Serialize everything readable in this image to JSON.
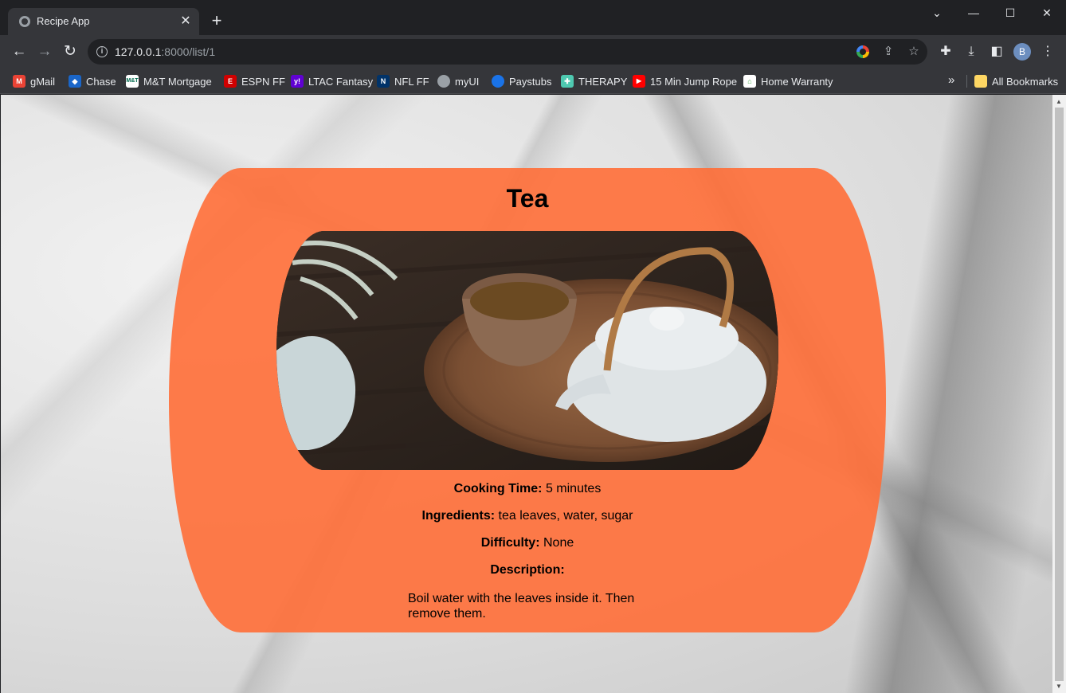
{
  "browser": {
    "tab_title": "Recipe App",
    "url_host": "127.0.0.1",
    "url_rest": ":8000/list/1",
    "profile_initial": "B"
  },
  "bookmarks": [
    {
      "label": "gMail",
      "icon": "gmail-icon",
      "color": "#ea4335"
    },
    {
      "label": "Chase",
      "icon": "chase-icon",
      "color": "#1a66c9"
    },
    {
      "label": "M&T Mortgage",
      "icon": "mt-icon",
      "color": "#ffffff"
    },
    {
      "label": "ESPN FF",
      "icon": "espn-icon",
      "color": "#d00000"
    },
    {
      "label": "LTAC Fantasy",
      "icon": "yahoo-icon",
      "color": "#6001d2"
    },
    {
      "label": "NFL FF",
      "icon": "nfl-icon",
      "color": "#013369"
    },
    {
      "label": "myUI",
      "icon": "globe-icon",
      "color": "#9aa0a6"
    },
    {
      "label": "Paystubs",
      "icon": "paystubs-icon",
      "color": "#1a73e8"
    },
    {
      "label": "THERAPY",
      "icon": "therapy-icon",
      "color": "#4ec9b0"
    },
    {
      "label": "15 Min Jump Rope",
      "icon": "youtube-icon",
      "color": "#ff0000"
    },
    {
      "label": "Home Warranty",
      "icon": "home-warranty-icon",
      "color": "#ffffff"
    }
  ],
  "all_bookmarks_label": "All Bookmarks",
  "recipe": {
    "title": "Tea",
    "cooking_time_label": "Cooking Time:",
    "cooking_time": "5 minutes",
    "ingredients_label": "Ingredients:",
    "ingredients": "tea leaves, water, sugar",
    "difficulty_label": "Difficulty:",
    "difficulty": "None",
    "description_label": "Description:",
    "description": "Boil water with the leaves inside it. Then remove them."
  },
  "colors": {
    "card": "#ff6e37",
    "chrome_dark": "#202124",
    "chrome_toolbar": "#35363a"
  }
}
